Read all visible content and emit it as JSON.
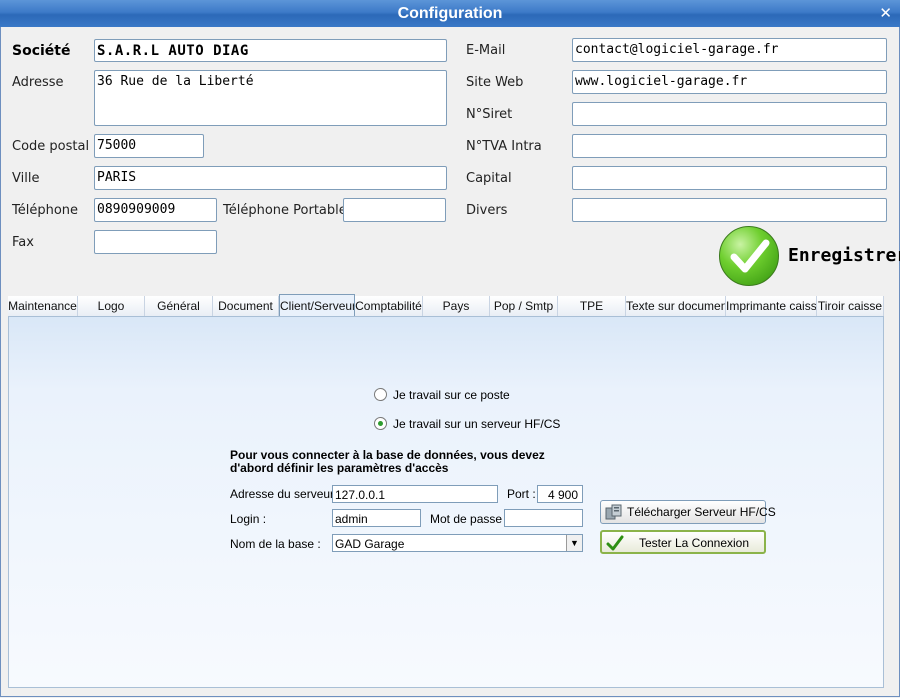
{
  "window": {
    "title": "Configuration"
  },
  "left": {
    "societe_label": "Société",
    "societe_value": "S.A.R.L AUTO DIAG",
    "adresse_label": "Adresse",
    "adresse_value": "36 Rue de la Liberté",
    "cp_label": "Code postal",
    "cp_value": "75000",
    "ville_label": "Ville",
    "ville_value": "PARIS",
    "tel_label": "Téléphone",
    "tel_value": "0890909009",
    "telport_label": "Téléphone Portable",
    "telport_value": "",
    "fax_label": "Fax",
    "fax_value": ""
  },
  "right": {
    "email_label": "E-Mail",
    "email_value": "contact@logiciel-garage.fr",
    "site_label": "Site Web",
    "site_value": "www.logiciel-garage.fr",
    "siret_label": "N°Siret",
    "siret_value": "",
    "tva_label": "N°TVA Intra",
    "tva_value": "",
    "capital_label": "Capital",
    "capital_value": "",
    "divers_label": "Divers",
    "divers_value": ""
  },
  "save_label": "Enregistrer",
  "tabs": [
    "Maintenance",
    "Logo",
    "Général",
    "Document",
    "Client/Serveur",
    "Comptabilité",
    "Pays",
    "Pop / Smtp",
    "TPE",
    "Texte sur document",
    "Imprimante caisse",
    "Tiroir caisse"
  ],
  "active_tab": "Client/Serveur",
  "panel": {
    "radio1": "Je travail sur ce poste",
    "radio2": "Je travail  sur un serveur HF/CS",
    "info_line1": "Pour vous connecter à la base de données, vous devez",
    "info_line2": "d'abord définir les paramètres d'accès",
    "server_label": "Adresse du serveur :",
    "server_value": "127.0.0.1",
    "port_label": "Port :",
    "port_value": "4 900",
    "login_label": "Login :",
    "login_value": "admin",
    "pwd_label": "Mot de passe :",
    "pwd_value": "",
    "base_label": "Nom de la base :",
    "base_value": "GAD Garage",
    "download_button": "Télécharger Serveur HF/CS",
    "test_button": "Tester La Connexion"
  },
  "colors": {
    "titlebar": "#3d7ac8",
    "accent_green": "#3b9b16",
    "field_border": "#7f9db9"
  },
  "icons": {
    "close": "close-icon",
    "save": "check-icon",
    "download": "server-icon",
    "test": "check-icon"
  }
}
